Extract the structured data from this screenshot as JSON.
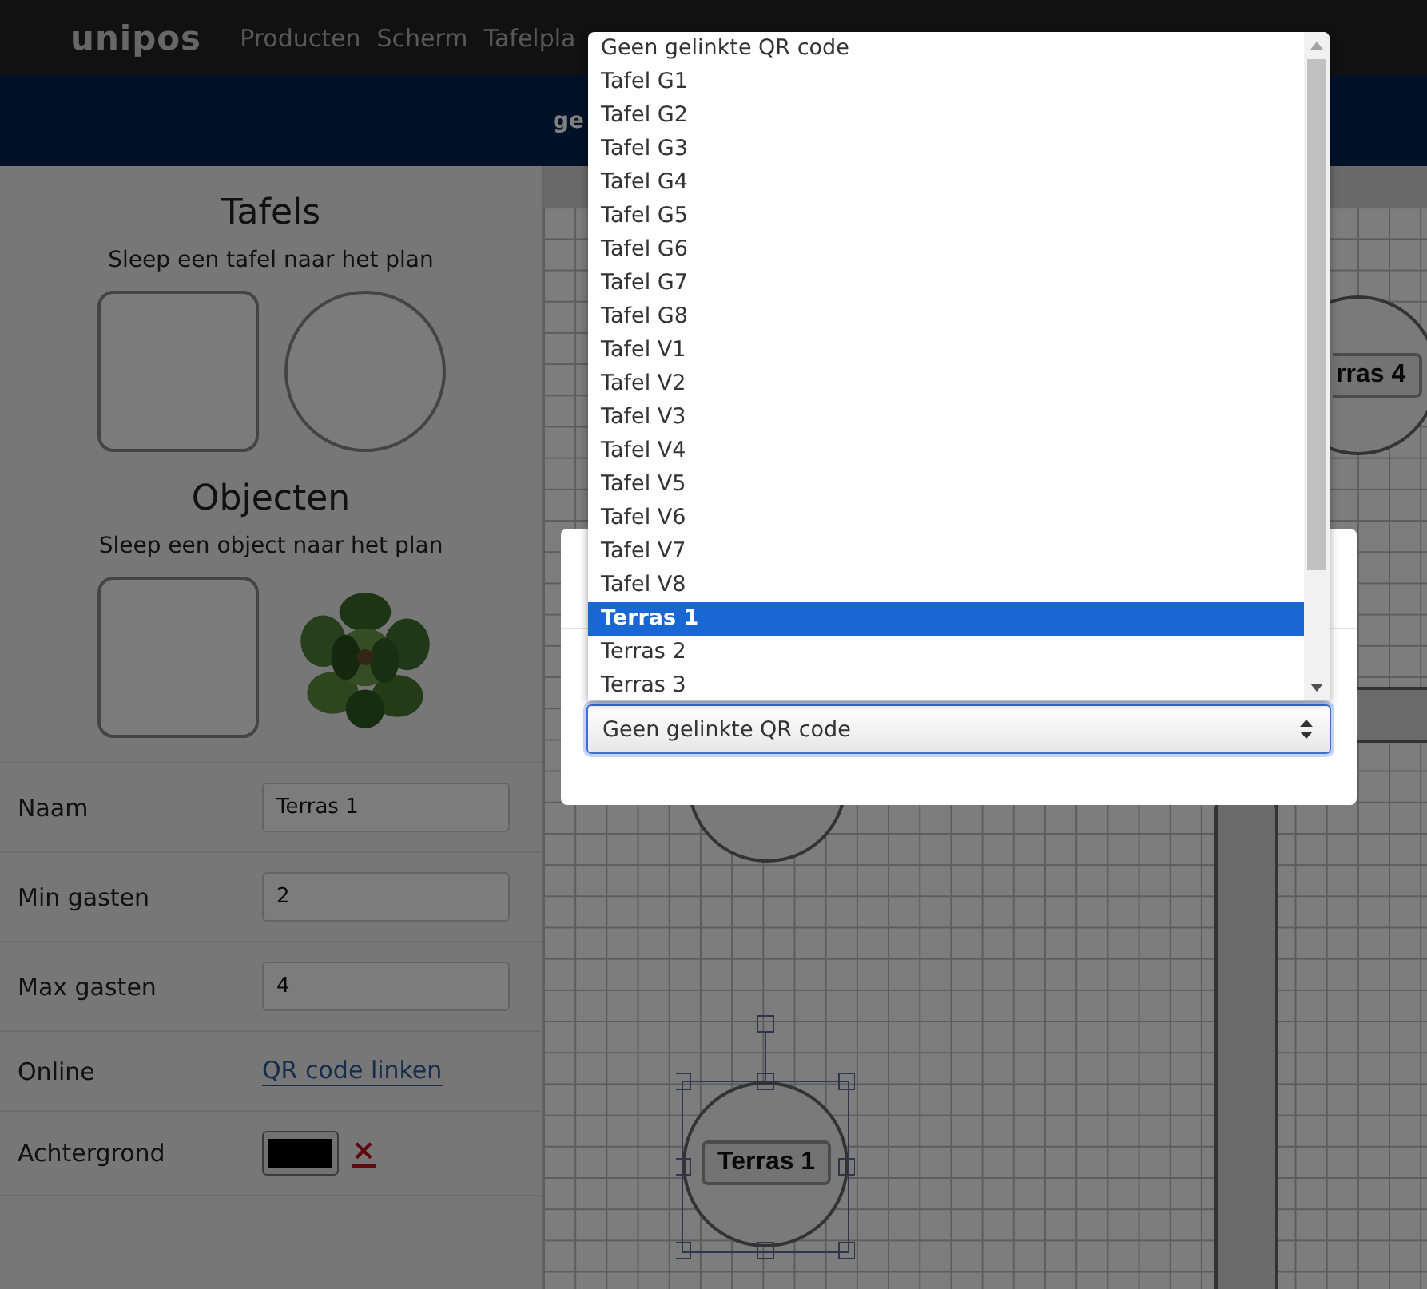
{
  "nav": {
    "logo": "unipos",
    "items": [
      "Producten",
      "Scherm",
      "Tafelpla"
    ]
  },
  "banner": {
    "text": "ge"
  },
  "palette": [
    {
      "title": "Tafels",
      "hint": "Sleep een tafel naar het plan",
      "items": [
        {
          "kind": "square"
        },
        {
          "kind": "circle"
        }
      ]
    },
    {
      "title": "Objecten",
      "hint": "Sleep een object naar het plan",
      "items": [
        {
          "kind": "square"
        },
        {
          "kind": "picture"
        }
      ]
    }
  ],
  "properties": [
    {
      "label": "Naam",
      "kind": "input",
      "value": "Terras 1"
    },
    {
      "label": "Min gasten",
      "kind": "input",
      "value": "2"
    },
    {
      "label": "Max gasten",
      "kind": "input",
      "value": "4"
    },
    {
      "label": "Online",
      "kind": "link",
      "value": "QR code linken"
    },
    {
      "label": "Achtergrond",
      "kind": "color",
      "color": "#000000",
      "clear": "×"
    }
  ],
  "floorplan": {
    "items": [
      {
        "kind": "circle",
        "label": "rras 4",
        "selected": false
      },
      {
        "kind": "circle",
        "selected": false
      },
      {
        "kind": "bar",
        "selected": false
      },
      {
        "kind": "bar",
        "selected": false
      },
      {
        "kind": "circle",
        "label": "Terras 1",
        "selected": true
      }
    ]
  },
  "qr_dialog": {
    "select": {
      "value": "Geen gelinkte QR code",
      "open": true,
      "options": [
        {
          "label": "Geen gelinkte QR code",
          "highlighted": false
        },
        {
          "label": "Tafel G1",
          "highlighted": false
        },
        {
          "label": "Tafel G2",
          "highlighted": false
        },
        {
          "label": "Tafel G3",
          "highlighted": false
        },
        {
          "label": "Tafel G4",
          "highlighted": false
        },
        {
          "label": "Tafel G5",
          "highlighted": false
        },
        {
          "label": "Tafel G6",
          "highlighted": false
        },
        {
          "label": "Tafel G7",
          "highlighted": false
        },
        {
          "label": "Tafel G8",
          "highlighted": false
        },
        {
          "label": "Tafel V1",
          "highlighted": false
        },
        {
          "label": "Tafel V2",
          "highlighted": false
        },
        {
          "label": "Tafel V3",
          "highlighted": false
        },
        {
          "label": "Tafel V4",
          "highlighted": false
        },
        {
          "label": "Tafel V5",
          "highlighted": false
        },
        {
          "label": "Tafel V6",
          "highlighted": false
        },
        {
          "label": "Tafel V7",
          "highlighted": false
        },
        {
          "label": "Tafel V8",
          "highlighted": false
        },
        {
          "label": "Terras 1",
          "highlighted": true
        },
        {
          "label": "Terras 2",
          "highlighted": false
        },
        {
          "label": "Terras 3",
          "highlighted": false
        }
      ]
    }
  }
}
